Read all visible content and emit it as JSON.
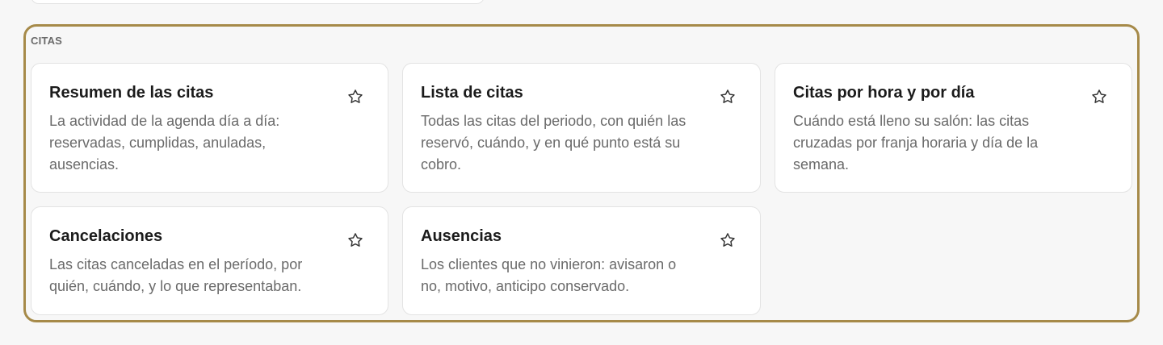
{
  "section": {
    "title": "CITAS"
  },
  "cards": [
    {
      "title": "Resumen de las citas",
      "description": "La actividad de la agenda día a día: reservadas, cumplidas, anuladas, ausencias."
    },
    {
      "title": "Lista de citas",
      "description": "Todas las citas del periodo, con quién las reservó, cuándo, y en qué punto está su cobro."
    },
    {
      "title": "Citas por hora y por día",
      "description": "Cuándo está lleno su salón: las citas cruzadas por franja horaria y día de la semana."
    },
    {
      "title": "Cancelaciones",
      "description": "Las citas canceladas en el período, por quién, cuándo, y lo que representaban."
    },
    {
      "title": "Ausencias",
      "description": "Los clientes que no vinieron: avisaron o no, motivo, anticipo conservado."
    }
  ],
  "icons": {
    "favorite": "star-outline-icon"
  },
  "colors": {
    "section_border": "#a68a49",
    "background": "#f7f7f7",
    "card_background": "#ffffff",
    "title_text": "#1b1b1b",
    "description_text": "#6a6a6a"
  }
}
